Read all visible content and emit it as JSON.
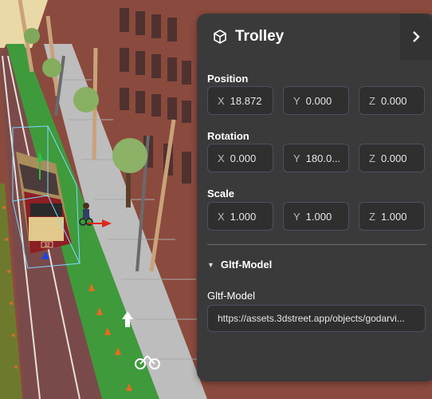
{
  "panel": {
    "title": "Trolley",
    "position": {
      "label": "Position",
      "x_axis": "X",
      "x": "18.872",
      "y_axis": "Y",
      "y": "0.000",
      "z_axis": "Z",
      "z": "0.000"
    },
    "rotation": {
      "label": "Rotation",
      "x_axis": "X",
      "x": "0.000",
      "y_axis": "Y",
      "y": "180.0...",
      "z_axis": "Z",
      "z": "0.000"
    },
    "scale": {
      "label": "Scale",
      "x_axis": "X",
      "x": "1.000",
      "y_axis": "Y",
      "y": "1.000",
      "z_axis": "Z",
      "z": "1.000"
    },
    "component": {
      "expander_label": "Gltf-Model",
      "field_label": "Gltf-Model",
      "url": "https://assets.3dstreet.app/objects/godarvi..."
    }
  },
  "scene": {
    "lane_label": "32"
  },
  "colors": {
    "panel_bg": "#3a3a3a",
    "field_border": "#4e4e66",
    "trolley_red": "#8c1f24",
    "bike_lane_green": "#3f9a3c",
    "sidewalk": "#bdbdbd",
    "road": "#7a4a4a"
  }
}
